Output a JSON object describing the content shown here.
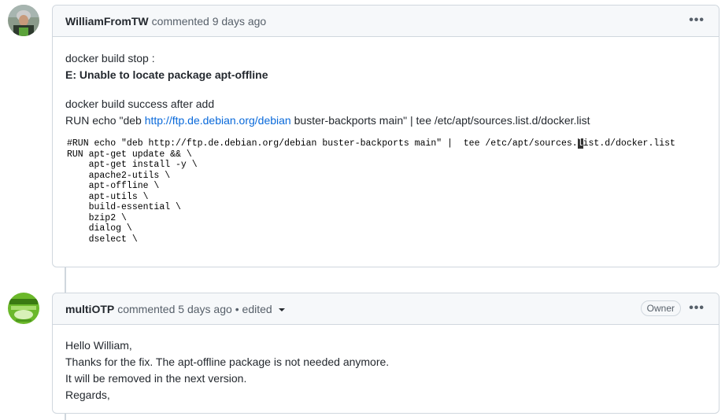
{
  "comments": [
    {
      "author": "WilliamFromTW",
      "meta": "commented 9 days ago",
      "lines": [
        "docker build stop :",
        "E: Unable to locate package apt-offline",
        "docker build success after add"
      ],
      "run_prefix": "RUN echo \"deb ",
      "run_link": "http://ftp.de.debian.org/debian",
      "run_suffix": " buster-backports main\" | tee /etc/apt/sources.list.d/docker.list",
      "code_lines": [
        "#RUN echo \"deb http://ftp.de.debian.org/debian buster-backports main\" |  tee /etc/apt/sources.",
        "l",
        "ist.d/docker.list",
        "RUN apt-get update && \\",
        "    apt-get install -y \\",
        "    apache2-utils \\",
        "    apt-offline \\",
        "    apt-utils \\",
        "    build-essential \\",
        "    bzip2 \\",
        "    dialog \\",
        "    dselect \\"
      ]
    },
    {
      "author": "multiOTP",
      "meta": "commented 5 days ago",
      "edited": "• edited",
      "badge": "Owner",
      "lines": [
        "Hello William,",
        "Thanks for the fix. The apt-offline package is not needed anymore.",
        "It will be removed in the next version.",
        "Regards,"
      ]
    }
  ],
  "icons": [
    "kebab-icon",
    "caret-down-icon"
  ]
}
